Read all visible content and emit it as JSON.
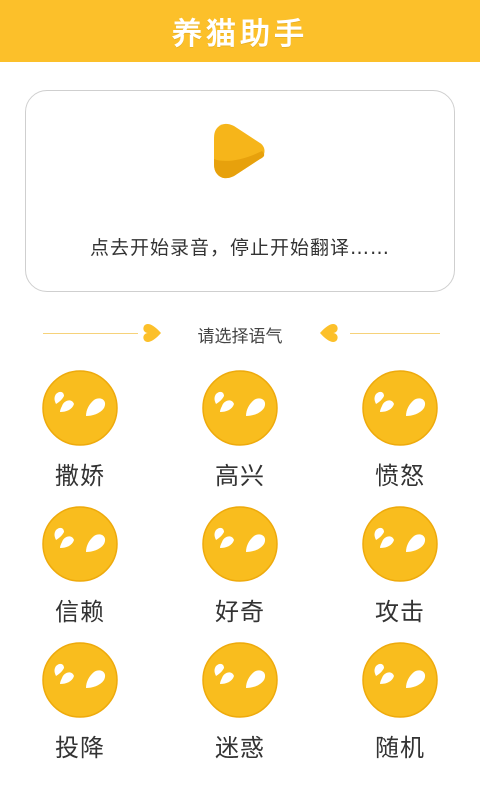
{
  "header": {
    "title": "养猫助手"
  },
  "record": {
    "hint": "点去开始录音，停止开始翻译……"
  },
  "section": {
    "title": "请选择语气"
  },
  "moods": [
    {
      "label": "撒娇"
    },
    {
      "label": "高兴"
    },
    {
      "label": "愤怒"
    },
    {
      "label": "信赖"
    },
    {
      "label": "好奇"
    },
    {
      "label": "攻击"
    },
    {
      "label": "投降"
    },
    {
      "label": "迷惑"
    },
    {
      "label": "随机"
    }
  ],
  "colors": {
    "brand_yellow": "#fcc02a",
    "face_yellow": "#f9bd1e",
    "text": "#333333"
  },
  "icons": {
    "play": "play-icon",
    "heart": "heart-icon",
    "mood_face": "cat-face-icon"
  }
}
